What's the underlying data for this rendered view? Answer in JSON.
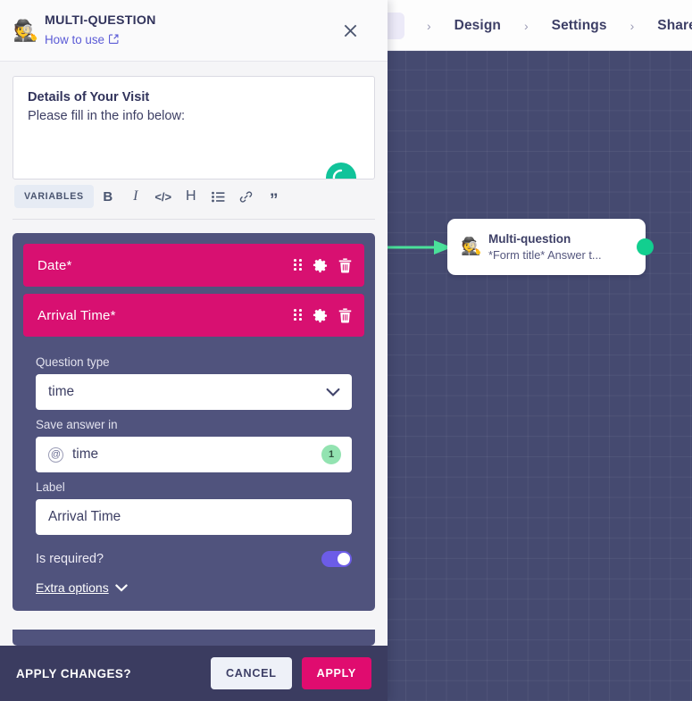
{
  "topbar": {
    "breadcrumbs": [
      {
        "sep": "›",
        "label": "Design"
      },
      {
        "sep": "›",
        "label": "Settings"
      },
      {
        "sep": "›",
        "label": "Share"
      }
    ]
  },
  "canvas": {
    "node": {
      "emoji": "🕵️",
      "emoji_name": "detective-emoji",
      "title": "Multi-question",
      "subtitle": "*Form title* Answer t...",
      "connector_color": "#12cf8f",
      "incoming_arrow_color": "#4ae09a"
    },
    "background_color": "#454a70"
  },
  "panel": {
    "header": {
      "emoji": "🕵️",
      "title": "MULTI-QUESTION",
      "link_label": "How to use",
      "link_icon": "external-link-icon",
      "close_icon": "close-icon"
    },
    "editor": {
      "heading": "Details of Your Visit",
      "paragraph": "Please fill in the info below:",
      "grammarly_badge": "G",
      "toolbar": {
        "variables_label": "VARIABLES",
        "buttons": [
          {
            "name": "bold-icon",
            "glyph": "B",
            "cls": "bold"
          },
          {
            "name": "italic-icon",
            "glyph": "I",
            "cls": "italic"
          },
          {
            "name": "code-icon",
            "glyph": "</>",
            "cls": "code"
          },
          {
            "name": "heading-icon",
            "glyph": "H",
            "cls": "head"
          },
          {
            "name": "bullet-list-icon",
            "glyph": "",
            "cls": "list"
          },
          {
            "name": "link-icon",
            "glyph": "",
            "cls": "link"
          },
          {
            "name": "quote-icon",
            "glyph": "”",
            "cls": "quote"
          }
        ]
      }
    },
    "questions": [
      {
        "label": "Date*",
        "expanded": false
      },
      {
        "label": "Arrival Time*",
        "expanded": true
      }
    ],
    "question_row_color": "#d81071",
    "detail": {
      "question_type_label": "Question type",
      "question_type_value": "time",
      "save_answer_label": "Save answer in",
      "save_answer_value": "time",
      "save_answer_prefix": "@",
      "save_answer_count": "1",
      "label_label": "Label",
      "label_value": "Arrival Time",
      "required_label": "Is required?",
      "required_on": true,
      "extra_options_label": "Extra options",
      "toggle_color": "#6c5ce7",
      "badge_color": "#93e3b1"
    },
    "footer": {
      "title": "APPLY CHANGES?",
      "cancel_label": "CANCEL",
      "apply_label": "APPLY",
      "apply_color": "#e00c6f"
    }
  }
}
